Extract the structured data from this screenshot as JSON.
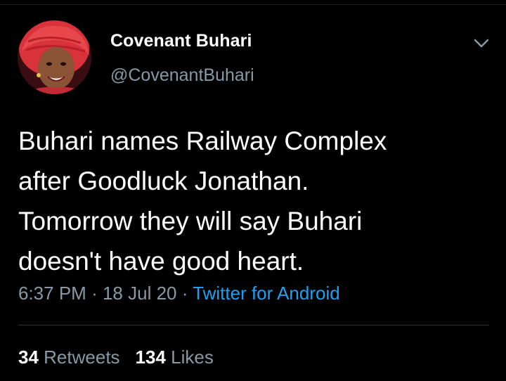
{
  "tweet": {
    "author": {
      "display_name": "Covenant Buhari",
      "handle": "@CovenantBuhari",
      "avatar_icon": "profile-avatar"
    },
    "menu_icon": "chevron-down-icon",
    "text": "Buhari names Railway Complex\nafter Goodluck Jonathan.\nTomorrow they will say Buhari\ndoesn't have good heart.",
    "time": "6:37 PM",
    "separator": "·",
    "date": "18 Jul 20",
    "source": "Twitter for Android",
    "stats": {
      "retweets_count": "34",
      "retweets_label": "Retweets",
      "likes_count": "134",
      "likes_label": "Likes"
    }
  },
  "colors": {
    "background": "#000000",
    "text_primary": "#ffffff",
    "text_secondary": "#8899a6",
    "link": "#1da1f2",
    "divider": "#2f3336"
  }
}
